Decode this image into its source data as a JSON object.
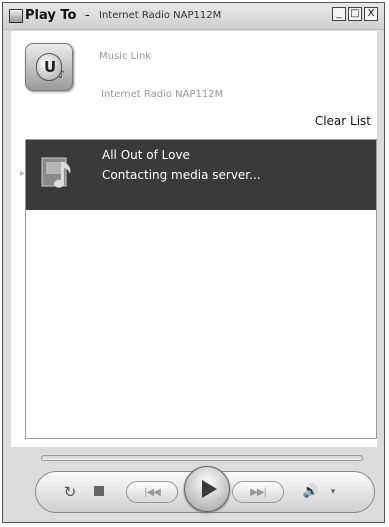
{
  "window": {
    "app_title": "Play To",
    "separator": "-",
    "device_title": "Internet Radio NAP112M",
    "controls": {
      "minimize": "_",
      "maximize": "□",
      "close": "X"
    }
  },
  "header": {
    "icon_letter": "U",
    "icon_note": "♪",
    "music_link": "Music Link",
    "device_name": "Internet Radio NAP112M",
    "clear_list": "Clear List"
  },
  "playlist": {
    "items": [
      {
        "title": "All Out of Love",
        "status": "Contacting media server..."
      }
    ]
  },
  "player": {
    "repeat_icon": "↻",
    "prev_icon": "|◀◀",
    "next_icon": "▶▶|",
    "volume_icon": "🔊",
    "volume_arrow": "▾"
  },
  "colors": {
    "selected_row": "#3a3a3a",
    "frame": "#dcdcdc",
    "content_bg": "#ffffff"
  }
}
